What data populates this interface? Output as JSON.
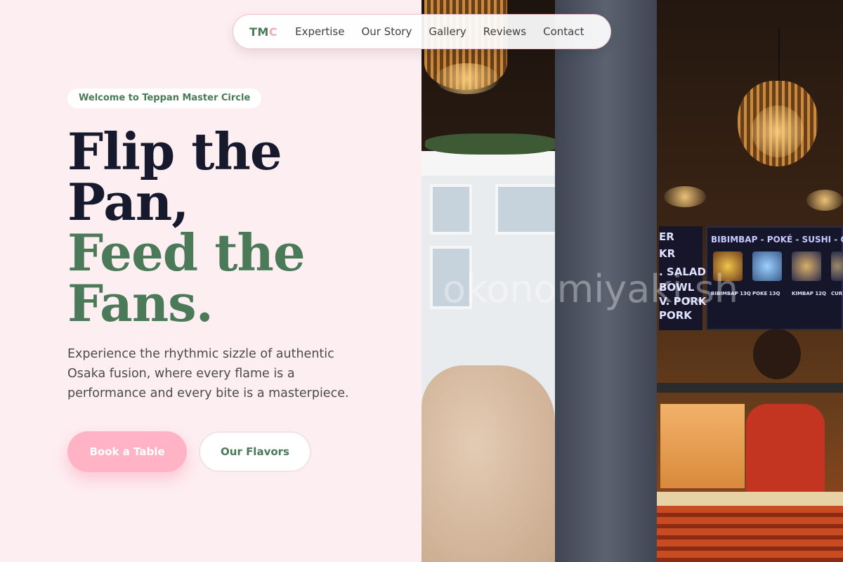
{
  "nav": {
    "logo_main": "TM",
    "logo_accent": "C",
    "links": [
      "Expertise",
      "Our Story",
      "Gallery",
      "Reviews",
      "Contact"
    ]
  },
  "hero": {
    "badge": "Welcome to Teppan Master Circle",
    "title_line1": "Flip the",
    "title_line2": "Pan,",
    "title_line3": "Feed the",
    "title_line4": "Fans.",
    "description": "Experience the rhythmic sizzle of authentic Osaka fusion, where every flame is a performance and every bite is a masterpiece."
  },
  "buttons": {
    "book": "Book a Table",
    "flavors": "Our Flavors"
  },
  "photo": {
    "menu_header": "BIBIMBAP - POKÉ - SUSHI - CURRY",
    "menu_left_lines": [
      "ER",
      "KR",
      ". SALAD",
      "BOWL",
      "V. PORK",
      "PORK"
    ],
    "menu_items": [
      "BIBIMBAP 13Q",
      "POKE 13Q",
      "KIMBAP 12Q",
      "CUR"
    ],
    "watermark": "okonomiyaki.sh"
  },
  "colors": {
    "background": "#fdeef2",
    "brand_green": "#4a7a58",
    "accent_pink": "#ffb3c4",
    "heading_dark": "#161a2c"
  }
}
